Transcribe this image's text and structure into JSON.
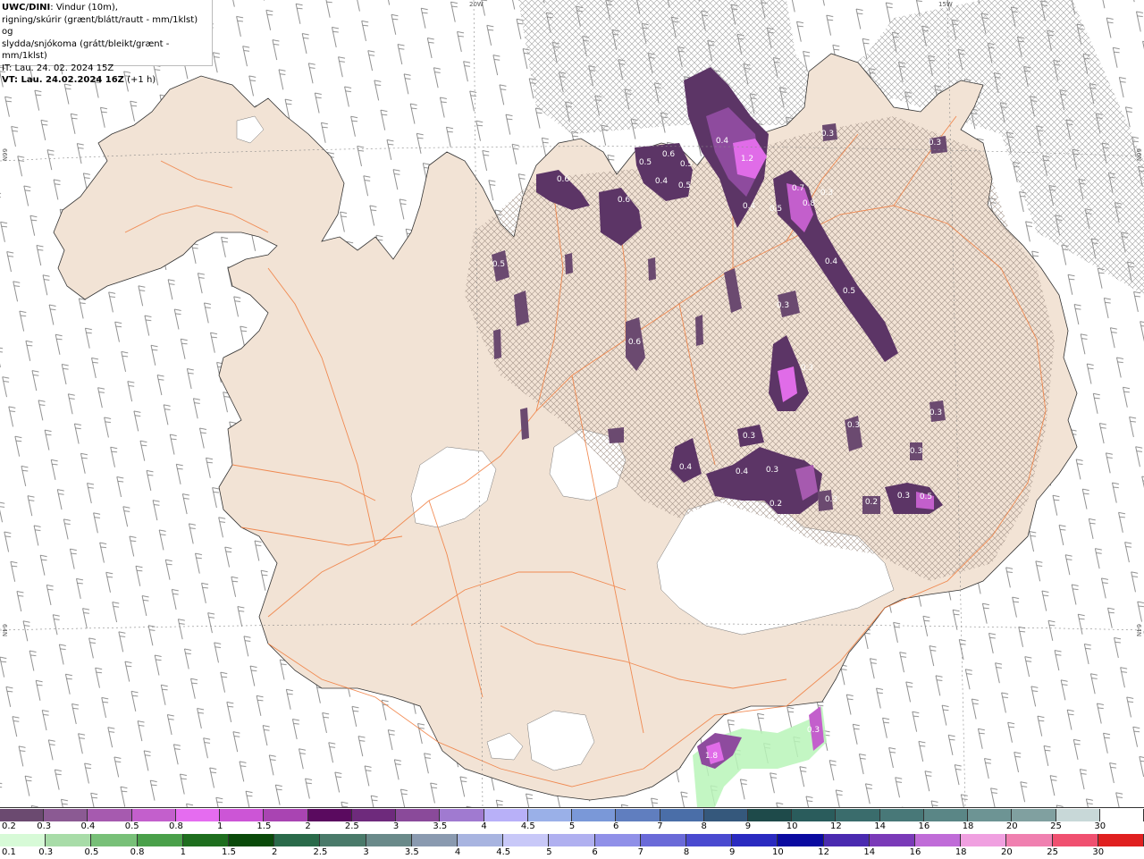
{
  "header": {
    "model": "UWC/DINI",
    "line1_rest": ": Vindur (10m),",
    "line2": "rigning/skúrir (grænt/blátt/rautt - mm/1klst) og",
    "line3": "slydda/snjókoma (grátt/bleikt/grænt - mm/1klst)",
    "line4": "IT: Lau. 24. 02. 2024 15Z",
    "line5_bold": "VT: Lau. 24.02.2024 16Z",
    "line5_rest": " (+1 h)"
  },
  "graticule": {
    "top_left": "20W",
    "top_right": "15W",
    "left_upper": "66N",
    "left_lower": "64N",
    "right_upper": "66N",
    "right_lower": "64N"
  },
  "colors": {
    "land": "#f2e3d5",
    "sea": "#ffffff",
    "roads": "#f07a3a",
    "snow_dark": "#5c3566",
    "snow_mid": "#8e4b9e",
    "snow_light": "#e06ce8",
    "rain_light": "#b8f4b8"
  },
  "value_labels": [
    {
      "text": "0.4",
      "pos": "north central"
    },
    {
      "text": "1.2",
      "pos": "north central"
    },
    {
      "text": "0.4",
      "pos": "north central"
    },
    {
      "text": "0.5",
      "pos": "north"
    },
    {
      "text": "0.8",
      "pos": "north"
    },
    {
      "text": "0.7",
      "pos": "north"
    },
    {
      "text": "0.3",
      "pos": "north"
    },
    {
      "text": "0.5",
      "pos": "northwest"
    },
    {
      "text": "0.6",
      "pos": "northwest"
    },
    {
      "text": "0.5",
      "pos": "northwest"
    },
    {
      "text": "0.5",
      "pos": "northwest"
    },
    {
      "text": "0.6",
      "pos": "northwest"
    },
    {
      "text": "0.4",
      "pos": "northwest"
    },
    {
      "text": "0.6",
      "pos": "northwest"
    },
    {
      "text": "0.5",
      "pos": "west"
    },
    {
      "text": "0.4",
      "pos": "northeast"
    },
    {
      "text": "0.5",
      "pos": "northeast"
    },
    {
      "text": "0.3",
      "pos": "northeast"
    },
    {
      "text": "0.3",
      "pos": "east"
    },
    {
      "text": "0.3",
      "pos": "center"
    },
    {
      "text": "0.3",
      "pos": "center"
    },
    {
      "text": "0.3",
      "pos": "center"
    },
    {
      "text": "0.4",
      "pos": "southcentral"
    },
    {
      "text": "0.4",
      "pos": "southcentral"
    },
    {
      "text": "0.3",
      "pos": "southcentral"
    },
    {
      "text": "0.2",
      "pos": "southcentral"
    },
    {
      "text": "0.3",
      "pos": "southcentral"
    },
    {
      "text": "0.2",
      "pos": "southcentral"
    },
    {
      "text": "0.3",
      "pos": "southeast"
    },
    {
      "text": "0.5",
      "pos": "southeast"
    },
    {
      "text": "0.3",
      "pos": "east"
    },
    {
      "text": "0.3",
      "pos": "east"
    },
    {
      "text": "1.8",
      "pos": "south"
    },
    {
      "text": "0.3",
      "pos": "south"
    },
    {
      "text": "0.6",
      "pos": "west"
    },
    {
      "text": "0.3",
      "pos": "east"
    }
  ],
  "legend_snow": {
    "labels": [
      "0.2",
      "0.3",
      "0.4",
      "0.5",
      "0.8",
      "1",
      "1.5",
      "2",
      "2.5",
      "3",
      "3.5",
      "4",
      "4.5",
      "5",
      "6",
      "7",
      "8",
      "9",
      "10",
      "12",
      "14",
      "16",
      "18",
      "20",
      "25",
      "30"
    ],
    "colors": [
      "#6b4a70",
      "#8b5a93",
      "#a65aaf",
      "#c35fcc",
      "#e56cf0",
      "#cc55d6",
      "#a944b2",
      "#5a0a5f",
      "#6e2a7c",
      "#8a4a9a",
      "#a07ad0",
      "#b8b0f8",
      "#9ab0e8",
      "#7a98d8",
      "#607ebf",
      "#4a6ea8",
      "#35587c",
      "#1e4a4a",
      "#2a5c5c",
      "#3a6c6c",
      "#487878",
      "#5a8686",
      "#6d9494",
      "#80a0a0",
      "#c8d8d8",
      "#ffffff"
    ]
  },
  "legend_rain": {
    "labels": [
      "0.1",
      "0.3",
      "0.5",
      "0.8",
      "1",
      "1.5",
      "2",
      "2.5",
      "3",
      "3.5",
      "4",
      "4.5",
      "5",
      "6",
      "7",
      "8",
      "9",
      "10",
      "12",
      "14",
      "16",
      "18",
      "20",
      "25",
      "30"
    ],
    "colors": [
      "#d7fad7",
      "#a8dca8",
      "#78c078",
      "#4aa04a",
      "#1e6e1e",
      "#0a4a0a",
      "#2a6a4a",
      "#4a7a6a",
      "#6a8a8a",
      "#8a9ab0",
      "#a8b4e0",
      "#c8c8f8",
      "#b0b0f0",
      "#9090e8",
      "#6a6ad8",
      "#4a4ad0",
      "#2a2ac0",
      "#0a0aa0",
      "#4a2ab0",
      "#7a3ab8",
      "#c06cd8",
      "#f0a0e0",
      "#f080b0",
      "#f05070",
      "#e02020"
    ]
  }
}
